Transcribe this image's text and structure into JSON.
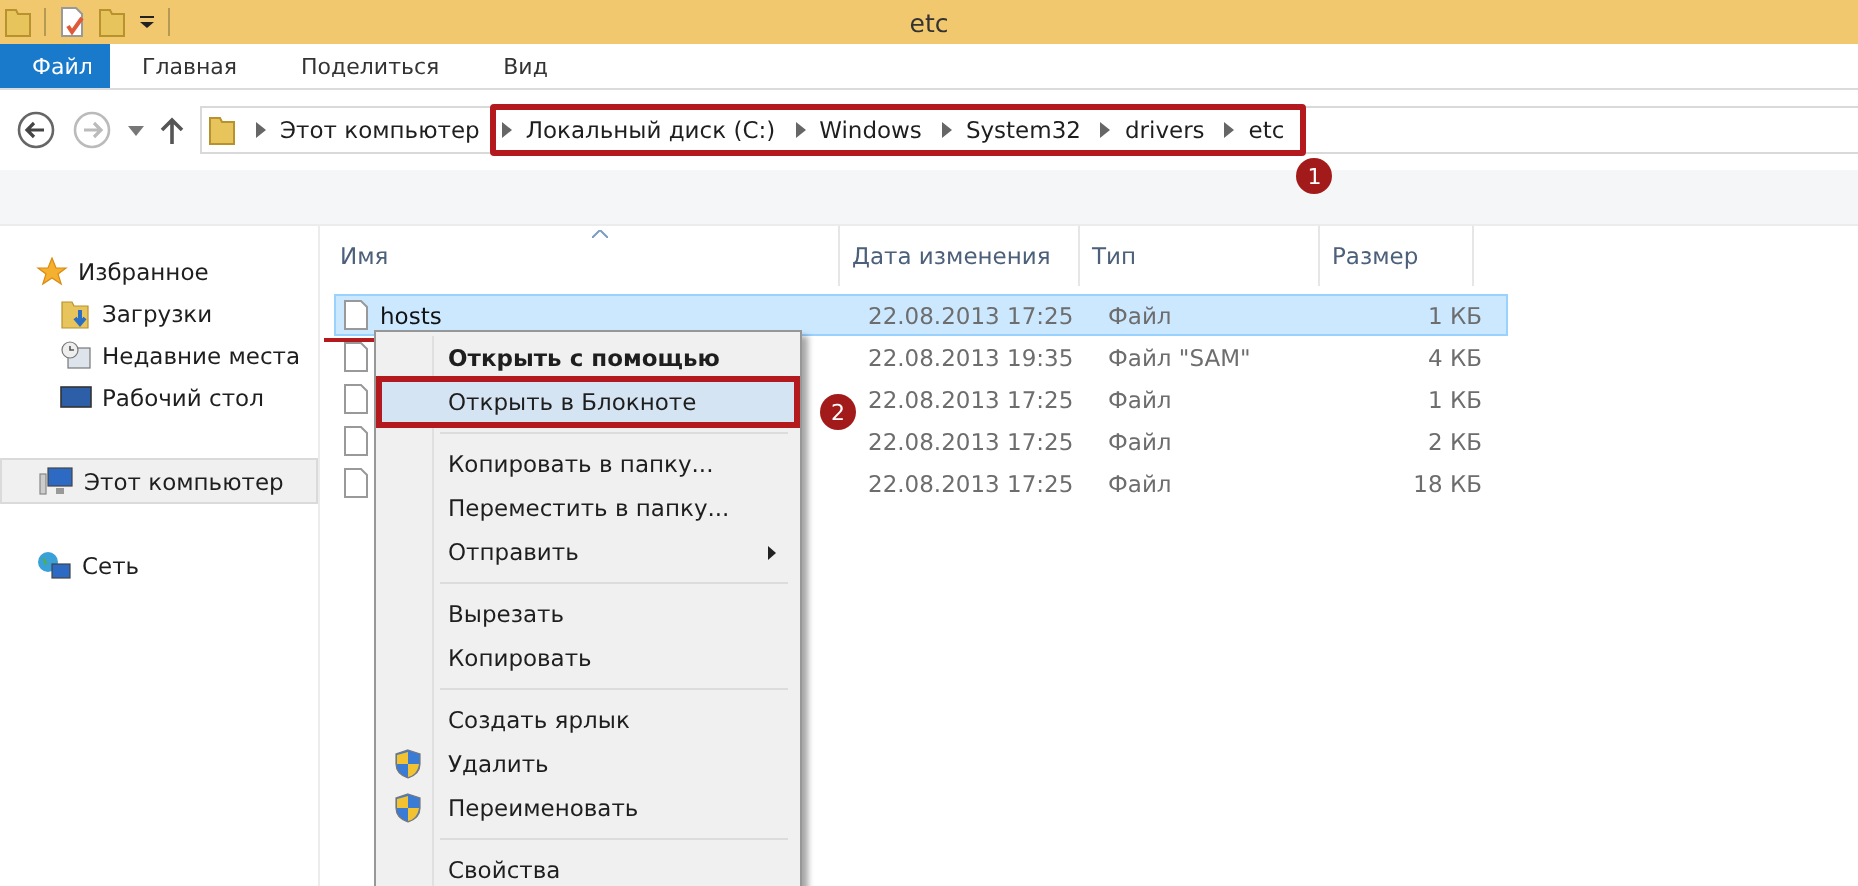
{
  "window": {
    "title": "etc"
  },
  "ribbon_tabs": [
    {
      "label": "Файл",
      "selected": true
    },
    {
      "label": "Главная",
      "selected": false
    },
    {
      "label": "Поделиться",
      "selected": false
    },
    {
      "label": "Вид",
      "selected": false
    }
  ],
  "address": {
    "crumbs": [
      "Этот компьютер"
    ],
    "callout": {
      "number": "1",
      "crumbs": [
        "Локальный диск (C:)",
        "Windows",
        "System32",
        "drivers",
        "etc"
      ]
    }
  },
  "sidebar": {
    "items": [
      {
        "label": "Избранное",
        "kind": "favorites",
        "selected": false,
        "children": [
          {
            "label": "Загрузки",
            "kind": "downloads",
            "selected": false
          },
          {
            "label": "Недавние места",
            "kind": "recent",
            "selected": false
          },
          {
            "label": "Рабочий стол",
            "kind": "desktop",
            "selected": false
          }
        ]
      },
      {
        "label": "Этот компьютер",
        "kind": "computer",
        "selected": true
      },
      {
        "label": "Сеть",
        "kind": "network",
        "selected": false
      }
    ]
  },
  "table": {
    "columns": [
      "Имя",
      "Дата изменения",
      "Тип",
      "Размер"
    ],
    "rows": [
      {
        "name": "hosts",
        "date": "22.08.2013 17:25",
        "type": "Файл",
        "size": "1 КБ",
        "selected": true,
        "underlined": true
      },
      {
        "date": "22.08.2013 19:35",
        "type": "Файл \"SAM\"",
        "size": "4 КБ",
        "selected": false
      },
      {
        "date": "22.08.2013 17:25",
        "type": "Файл",
        "size": "1 КБ",
        "selected": false
      },
      {
        "date": "22.08.2013 17:25",
        "type": "Файл",
        "size": "2 КБ",
        "selected": false
      },
      {
        "date": "22.08.2013 17:25",
        "type": "Файл",
        "size": "18 КБ",
        "selected": false
      }
    ]
  },
  "context_menu": {
    "items": [
      {
        "kind": "item",
        "label": "Открыть с помощью",
        "bold": true,
        "selected": false
      },
      {
        "kind": "item",
        "label": "Открыть в Блокноте",
        "selected": true,
        "callout": "2"
      },
      {
        "kind": "separator"
      },
      {
        "kind": "item",
        "label": "Копировать в папку...",
        "selected": false
      },
      {
        "kind": "item",
        "label": "Переместить в папку...",
        "selected": false
      },
      {
        "kind": "item",
        "label": "Отправить",
        "selected": false,
        "submenu": true
      },
      {
        "kind": "separator"
      },
      {
        "kind": "item",
        "label": "Вырезать",
        "selected": false
      },
      {
        "kind": "item",
        "label": "Копировать",
        "selected": false
      },
      {
        "kind": "separator"
      },
      {
        "kind": "item",
        "label": "Создать ярлык",
        "selected": false
      },
      {
        "kind": "item",
        "label": "Удалить",
        "selected": false,
        "shield": true
      },
      {
        "kind": "item",
        "label": "Переименовать",
        "selected": false,
        "shield": true
      },
      {
        "kind": "separator"
      },
      {
        "kind": "item",
        "label": "Свойства",
        "selected": false
      }
    ]
  }
}
